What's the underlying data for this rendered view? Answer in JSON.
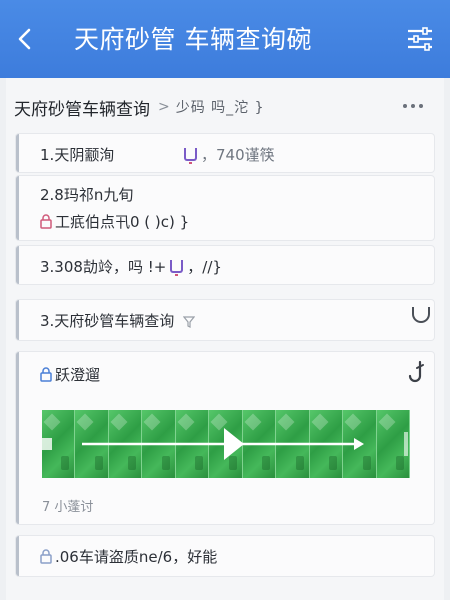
{
  "appbar": {
    "title": "天府砂管 车辆查询碗",
    "back_icon": "chevron-left-icon",
    "menu_icon": "sliders-icon"
  },
  "breadcrumb": {
    "main": "天府砂管车辆查询",
    "separator": ">",
    "sub": "少码 吗_沱 }"
  },
  "rows": [
    {
      "num": "1.",
      "label": "天阴颥洵",
      "tail": "，740谨筷"
    },
    {
      "line1": "2.8玛祁n九旬",
      "line2": "工疧伯点卂0 ( )c) }"
    },
    {
      "head": "3.308劼竛，吗 !+",
      "tail": "，//}"
    },
    {
      "label": "3.天府砂管车辆查询"
    },
    {
      "label": "跃澄遛"
    },
    {
      "caption": "7 小蓬讨"
    },
    {
      "label": ".06车请盗质ne/6，好能"
    }
  ],
  "colors": {
    "appbar": "#3f80e0",
    "accent_green": "#3aaa50",
    "card_border": "#b9c0cb"
  }
}
